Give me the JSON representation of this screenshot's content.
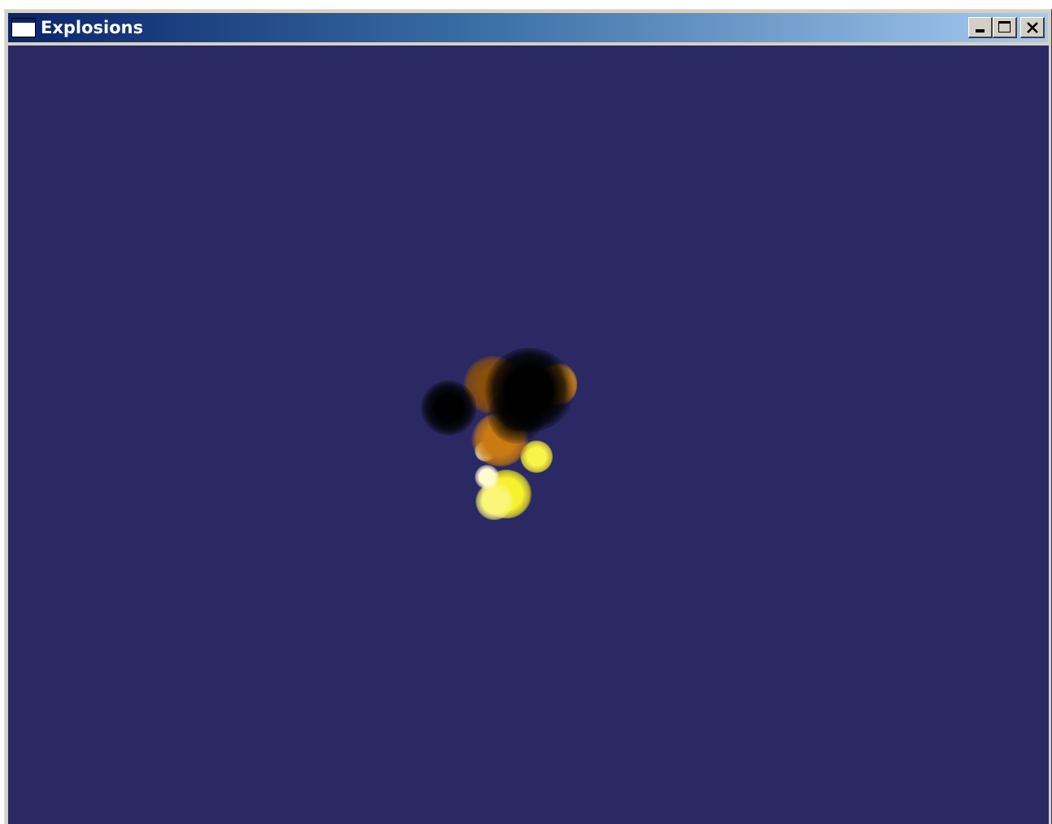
{
  "window": {
    "title": "Explosions",
    "icon": "window-icon",
    "controls": {
      "minimize_icon": "minimize-icon",
      "maximize_icon": "maximize-icon",
      "close_icon": "close-icon"
    }
  },
  "scene": {
    "background_color": "#2a2964",
    "explosion_colors": {
      "smoke": "#000000",
      "fire_orange": "#c87a10",
      "fire_yellow": "#f5f020",
      "core_white": "#fffff0"
    }
  }
}
